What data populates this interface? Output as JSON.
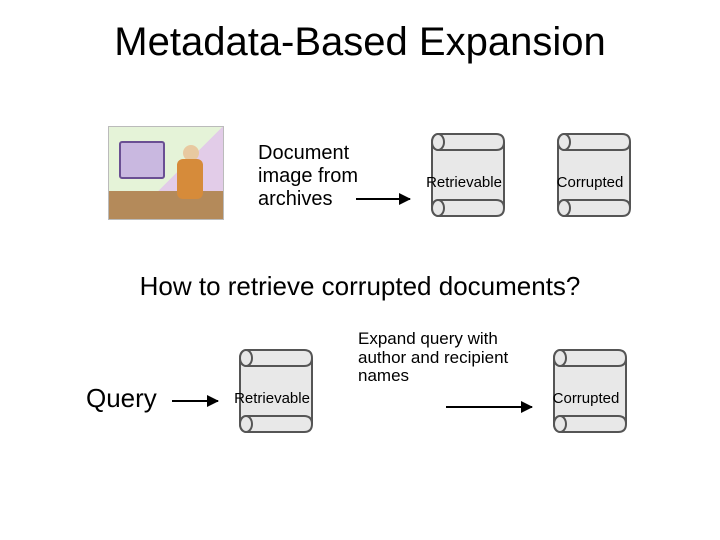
{
  "title": "Metadata-Based Expansion",
  "top": {
    "illustration_alt": "Document image from archives",
    "archives_label": "Document image from archives",
    "scroll_retrievable": "Retrievable",
    "scroll_corrupted": "Corrupted"
  },
  "question": "How to retrieve corrupted documents?",
  "bottom": {
    "query_label": "Query",
    "scroll_retrievable": "Retrievable",
    "expand_label": "Expand query with author and recipient names",
    "scroll_corrupted": "Corrupted"
  }
}
